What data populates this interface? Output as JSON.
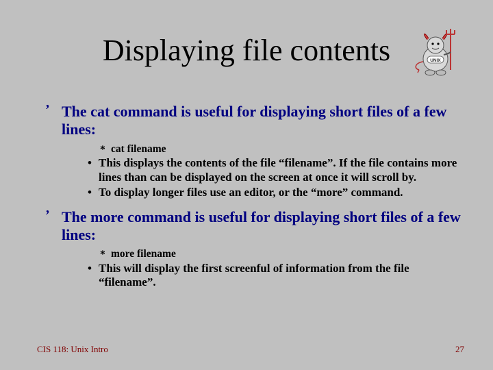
{
  "title": "Displaying file contents",
  "bullets": [
    {
      "text": "The cat command is useful for displaying short files of a few lines:",
      "cmd": "cat filename",
      "subs": [
        "This displays the contents of the file “filename”. If the file contains more lines than can be displayed on the screen at once it will scroll by.",
        "To display longer files use an editor, or the “more” command."
      ]
    },
    {
      "text": "The more command is useful for displaying short files of a few lines:",
      "cmd": "more filename",
      "subs": [
        "This will display the first screenful of information from the file “filename”."
      ]
    }
  ],
  "footer": {
    "left": "CIS 118: Unix Intro",
    "right": "27"
  }
}
